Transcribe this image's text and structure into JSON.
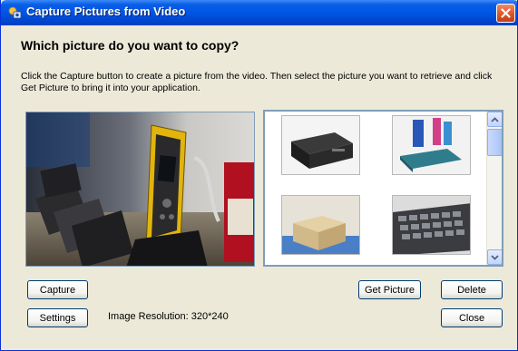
{
  "window": {
    "title": "Capture Pictures from Video",
    "close_icon": "close-icon"
  },
  "heading": "Which picture do you want to copy?",
  "instructions": "Click the Capture button to create a picture from the video. Then select the picture you want to retrieve and click Get Picture to bring it into your application.",
  "buttons": {
    "capture": "Capture",
    "settings": "Settings",
    "get_picture": "Get Picture",
    "delete": "Delete",
    "close": "Close"
  },
  "resolution_text": "Image Resolution: 320*240",
  "thumbnails": [
    "computer-case-photo",
    "blue-gadget-photo",
    "boxes-photo",
    "keyboard-photo"
  ],
  "colors": {
    "title_bar": "#0058e6",
    "dialog_bg": "#ece9d8",
    "close_button": "#e3572e",
    "button_border": "#003c74"
  }
}
